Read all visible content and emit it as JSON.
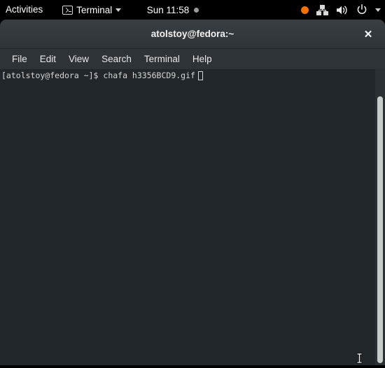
{
  "topbar": {
    "activities_label": "Activities",
    "app_name": "Terminal",
    "app_icon": "terminal-icon",
    "app_menu_caret": "chevron-down-icon",
    "clock": "Sun 11:58",
    "notification_dot": "notification-indicator-dot",
    "recording_indicator": "screen-recording-dot",
    "network_icon": "wired-network-icon",
    "volume_icon": "volume-speaker-icon",
    "power_icon": "power-icon",
    "system_menu_caret": "chevron-down-icon",
    "colors": {
      "background": "#000000",
      "text": "#ffffff",
      "recording_dot": "#ef7203",
      "notification_dot": "#9a9a9a"
    }
  },
  "window": {
    "title": "atolstoy@fedora:~",
    "close_label": "✕",
    "menus": [
      {
        "label": "File"
      },
      {
        "label": "Edit"
      },
      {
        "label": "View"
      },
      {
        "label": "Search"
      },
      {
        "label": "Terminal"
      },
      {
        "label": "Help"
      }
    ],
    "colors": {
      "titlebar": "#33383c",
      "menubar": "#2e3338",
      "terminal_background": "#22272b",
      "terminal_foreground": "#d6d6d6",
      "scrollbar_track": "#2b3034",
      "scrollbar_thumb": "#c9cdc9"
    }
  },
  "terminal": {
    "prompt": "[atolstoy@fedora ~]$",
    "command": "chafa h3356BCD9.gif",
    "line": "[atolstoy@fedora ~]$ chafa h3356BCD9.gif",
    "cursor": "block-cursor-outline"
  },
  "pointer": {
    "type": "i-beam-text-cursor"
  }
}
